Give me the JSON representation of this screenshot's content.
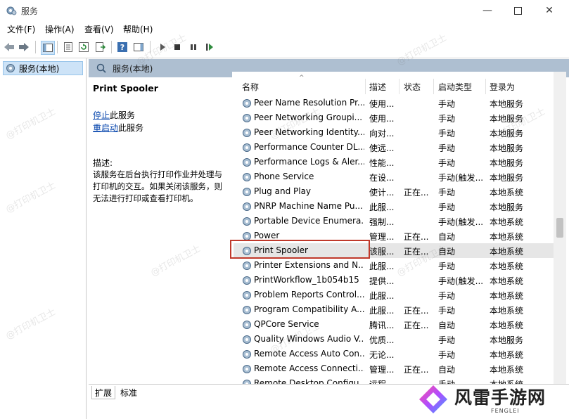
{
  "window": {
    "title": "服务"
  },
  "menu": {
    "items": [
      "文件(F)",
      "操作(A)",
      "查看(V)",
      "帮助(H)"
    ]
  },
  "tree": {
    "root": "服务(本地)"
  },
  "pane": {
    "header": "服务(本地)"
  },
  "details": {
    "service_name": "Print Spooler",
    "stop_link": "停止",
    "stop_suffix": "此服务",
    "restart_link": "重启动",
    "restart_suffix": "此服务",
    "desc_label": "描述:",
    "desc_text": "该服务在后台执行打印作业并处理与打印机的交互。如果关闭该服务，则无法进行打印或查看打印机。"
  },
  "list": {
    "columns": [
      "名称",
      "描述",
      "状态",
      "启动类型",
      "登录为"
    ],
    "rows": [
      {
        "name": "Peer Name Resolution Pr...",
        "desc": "使用...",
        "status": "",
        "startup": "手动",
        "logon": "本地服务"
      },
      {
        "name": "Peer Networking Groupi...",
        "desc": "使用...",
        "status": "",
        "startup": "手动",
        "logon": "本地服务"
      },
      {
        "name": "Peer Networking Identity...",
        "desc": "向对...",
        "status": "",
        "startup": "手动",
        "logon": "本地服务"
      },
      {
        "name": "Performance Counter DL...",
        "desc": "使远...",
        "status": "",
        "startup": "手动",
        "logon": "本地服务"
      },
      {
        "name": "Performance Logs & Aler...",
        "desc": "性能...",
        "status": "",
        "startup": "手动",
        "logon": "本地服务"
      },
      {
        "name": "Phone Service",
        "desc": "在设...",
        "status": "",
        "startup": "手动(触发...",
        "logon": "本地服务"
      },
      {
        "name": "Plug and Play",
        "desc": "使计...",
        "status": "正在...",
        "startup": "手动",
        "logon": "本地系统"
      },
      {
        "name": "PNRP Machine Name Pu...",
        "desc": "此服...",
        "status": "",
        "startup": "手动",
        "logon": "本地服务"
      },
      {
        "name": "Portable Device Enumera...",
        "desc": "强制...",
        "status": "",
        "startup": "手动(触发...",
        "logon": "本地系统"
      },
      {
        "name": "Power",
        "desc": "管理...",
        "status": "正在...",
        "startup": "自动",
        "logon": "本地系统"
      },
      {
        "name": "Print Spooler",
        "desc": "该服...",
        "status": "正在...",
        "startup": "自动",
        "logon": "本地系统"
      },
      {
        "name": "Printer Extensions and N...",
        "desc": "此服...",
        "status": "",
        "startup": "手动",
        "logon": "本地系统"
      },
      {
        "name": "PrintWorkflow_1b054b15",
        "desc": "提供...",
        "status": "",
        "startup": "手动(触发...",
        "logon": "本地系统"
      },
      {
        "name": "Problem Reports Control...",
        "desc": "此服...",
        "status": "",
        "startup": "手动",
        "logon": "本地系统"
      },
      {
        "name": "Program Compatibility A...",
        "desc": "此服...",
        "status": "正在...",
        "startup": "手动",
        "logon": "本地系统"
      },
      {
        "name": "QPCore Service",
        "desc": "腾讯...",
        "status": "正在...",
        "startup": "自动",
        "logon": "本地系统"
      },
      {
        "name": "Quality Windows Audio V...",
        "desc": "优质...",
        "status": "",
        "startup": "手动",
        "logon": "本地服务"
      },
      {
        "name": "Remote Access Auto Con...",
        "desc": "无论...",
        "status": "",
        "startup": "手动",
        "logon": "本地系统"
      },
      {
        "name": "Remote Access Connecti...",
        "desc": "管理...",
        "status": "正在...",
        "startup": "自动",
        "logon": "本地系统"
      },
      {
        "name": "Remote Desktop Configu...",
        "desc": "远程...",
        "status": "",
        "startup": "手动",
        "logon": "本地系统"
      }
    ]
  },
  "tabs": [
    "扩展",
    "标准"
  ],
  "watermark": "@打印机卫士",
  "brand": {
    "name": "风雷手游网",
    "sub": "FENGLEI"
  },
  "colors": {
    "accent": "#0645ad",
    "highlight": "#c0392b",
    "header": "#aebfd1"
  }
}
